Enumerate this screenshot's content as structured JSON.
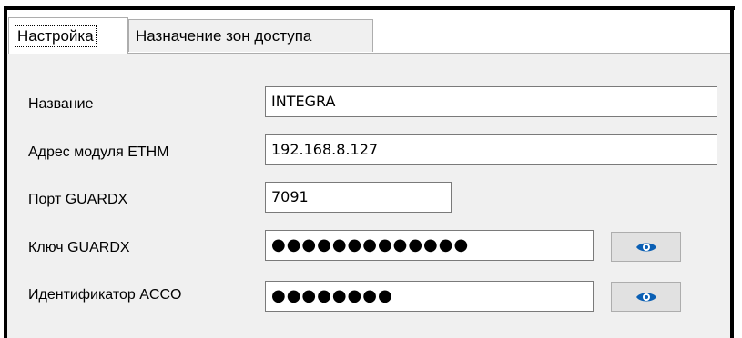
{
  "tabs": [
    {
      "label": "Настройка",
      "active": true
    },
    {
      "label": "Назначение зон доступа",
      "active": false
    }
  ],
  "form": {
    "name_label": "Название",
    "name_value": "INTEGRA",
    "address_label": "Адрес модуля ETHM",
    "address_value": "192.168.8.127",
    "port_label": "Порт GUARDX",
    "port_value": "7091",
    "key_label": "Ключ GUARDX",
    "key_value": "●●●●●●●●●●●●●",
    "id_label": "Идентификатор ACCO",
    "id_value": "●●●●●●●●"
  },
  "icons": {
    "show_key": "eye-icon",
    "show_id": "eye-icon"
  },
  "colors": {
    "accent_blue": "#0a5fb4",
    "window_bg": "#f0f0f0"
  }
}
